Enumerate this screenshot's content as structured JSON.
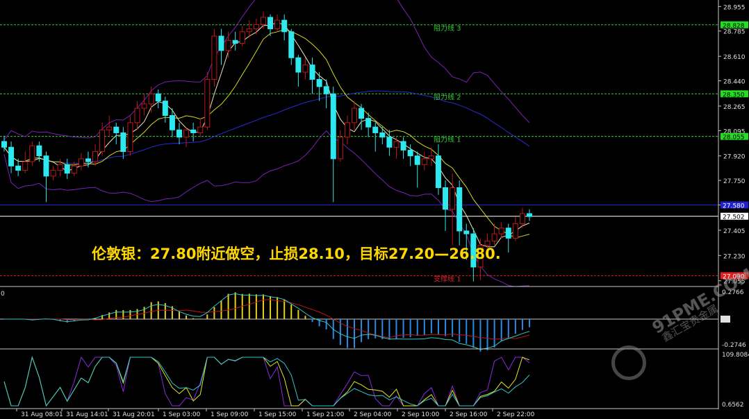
{
  "annotation": "伦敦银：27.80附近做空，止损28.10，目标27.20—26.80.",
  "watermark": {
    "site": "91PME.COM",
    "sub": "鑫汇宝贵金属"
  },
  "chart_data": {
    "type": "candlestick",
    "price_axis": {
      "ticks": [
        "28.955",
        "28.785",
        "28.610",
        "28.440",
        "28.265",
        "28.095",
        "27.920",
        "27.750",
        "27.580",
        "27.405",
        "27.230",
        "27.055"
      ],
      "ylim": [
        27.02,
        29.0
      ]
    },
    "time_axis": {
      "labels": [
        "31 Aug 08:01",
        "31 Aug 14:01",
        "31 Aug 20:01",
        "1 Sep 03:00",
        "1 Sep 09:00",
        "1 Sep 15:00",
        "1 Sep 21:00",
        "2 Sep 04:00",
        "2 Sep 10:00",
        "2 Sep 16:00",
        "2 Sep 22:00"
      ]
    },
    "levels": [
      {
        "label": "阻力线 3",
        "value": 28.828,
        "tag": "28.828",
        "color": "#2fcf2f"
      },
      {
        "label": "阻力线 2",
        "value": 28.35,
        "tag": "28.350",
        "color": "#2fcf2f"
      },
      {
        "label": "阻力线 1",
        "value": 28.055,
        "tag": "28.055",
        "color": "#2fcf2f"
      },
      {
        "label": "",
        "value": 27.58,
        "tag": "27.580",
        "color": "#2020d0"
      },
      {
        "label": "",
        "value": 27.502,
        "tag": "27.502",
        "color": "#ffffff"
      },
      {
        "label": "支撑线 1",
        "value": 27.09,
        "tag": "27.090",
        "color": "#e02020"
      }
    ],
    "candles": [
      [
        28.02,
        27.98,
        28.06,
        27.95
      ],
      [
        27.98,
        27.85,
        28.02,
        27.8
      ],
      [
        27.85,
        27.82,
        27.9,
        27.78
      ],
      [
        27.82,
        27.88,
        27.95,
        27.8
      ],
      [
        27.88,
        27.99,
        28.02,
        27.85
      ],
      [
        27.99,
        27.92,
        28.02,
        27.88
      ],
      [
        27.92,
        27.78,
        27.95,
        27.6
      ],
      [
        27.78,
        27.82,
        27.85,
        27.75
      ],
      [
        27.82,
        27.86,
        27.9,
        27.78
      ],
      [
        27.86,
        27.8,
        27.9,
        27.76
      ],
      [
        27.8,
        27.85,
        27.88,
        27.78
      ],
      [
        27.85,
        27.9,
        27.94,
        27.82
      ],
      [
        27.9,
        27.88,
        27.95,
        27.84
      ],
      [
        27.88,
        27.95,
        28.0,
        27.85
      ],
      [
        27.95,
        28.1,
        28.15,
        27.92
      ],
      [
        28.1,
        28.12,
        28.2,
        28.05
      ],
      [
        28.12,
        28.08,
        28.15,
        28.0
      ],
      [
        28.08,
        27.95,
        28.12,
        27.9
      ],
      [
        27.95,
        28.15,
        28.2,
        27.92
      ],
      [
        28.15,
        28.25,
        28.3,
        28.1
      ],
      [
        28.25,
        28.28,
        28.35,
        28.2
      ],
      [
        28.28,
        28.35,
        28.4,
        28.22
      ],
      [
        28.35,
        28.3,
        28.38,
        28.25
      ],
      [
        28.3,
        28.2,
        28.33,
        28.15
      ],
      [
        28.2,
        28.1,
        28.25,
        28.05
      ],
      [
        28.1,
        28.05,
        28.15,
        28.0
      ],
      [
        28.05,
        28.1,
        28.12,
        27.98
      ],
      [
        28.1,
        28.08,
        28.15,
        28.02
      ],
      [
        28.08,
        28.12,
        28.18,
        28.05
      ],
      [
        28.12,
        28.45,
        28.5,
        28.1
      ],
      [
        28.45,
        28.75,
        28.8,
        28.4
      ],
      [
        28.75,
        28.65,
        28.8,
        28.55
      ],
      [
        28.65,
        28.72,
        28.78,
        28.6
      ],
      [
        28.72,
        28.7,
        28.78,
        28.65
      ],
      [
        28.7,
        28.78,
        28.82,
        28.68
      ],
      [
        28.78,
        28.8,
        28.86,
        28.74
      ],
      [
        28.8,
        28.83,
        28.87,
        28.76
      ],
      [
        28.83,
        28.88,
        28.92,
        28.8
      ],
      [
        28.88,
        28.8,
        28.9,
        28.75
      ],
      [
        28.8,
        28.86,
        28.9,
        28.78
      ],
      [
        28.86,
        28.78,
        28.9,
        28.72
      ],
      [
        28.78,
        28.6,
        28.8,
        28.55
      ],
      [
        28.6,
        28.5,
        28.62,
        28.4
      ],
      [
        28.5,
        28.55,
        28.6,
        28.45
      ],
      [
        28.55,
        28.45,
        28.6,
        28.35
      ],
      [
        28.45,
        28.4,
        28.5,
        28.3
      ],
      [
        28.4,
        28.35,
        28.45,
        28.25
      ],
      [
        28.35,
        27.9,
        28.4,
        27.6
      ],
      [
        27.9,
        28.05,
        28.1,
        27.88
      ],
      [
        28.05,
        28.15,
        28.2,
        28.0
      ],
      [
        28.15,
        28.25,
        28.3,
        28.1
      ],
      [
        28.25,
        28.18,
        28.28,
        28.1
      ],
      [
        28.18,
        28.12,
        28.22,
        28.05
      ],
      [
        28.12,
        28.08,
        28.15,
        27.95
      ],
      [
        28.08,
        28.05,
        28.12,
        28.0
      ],
      [
        28.05,
        27.98,
        28.1,
        27.92
      ],
      [
        27.98,
        28.02,
        28.05,
        27.9
      ],
      [
        28.02,
        27.96,
        28.05,
        27.9
      ],
      [
        27.96,
        27.92,
        28.0,
        27.85
      ],
      [
        27.92,
        27.86,
        27.95,
        27.7
      ],
      [
        27.86,
        27.9,
        27.95,
        27.82
      ],
      [
        27.9,
        27.92,
        27.98,
        27.85
      ],
      [
        27.92,
        27.7,
        28.0,
        27.65
      ],
      [
        27.7,
        27.55,
        27.75,
        27.4
      ],
      [
        27.55,
        27.7,
        27.8,
        27.3
      ],
      [
        27.7,
        27.4,
        27.75,
        27.3
      ],
      [
        27.4,
        27.38,
        27.45,
        27.2
      ],
      [
        27.38,
        27.15,
        27.42,
        27.05
      ],
      [
        27.15,
        27.3,
        27.35,
        27.06
      ],
      [
        27.3,
        27.33,
        27.38,
        27.28
      ],
      [
        27.33,
        27.38,
        27.45,
        27.3
      ],
      [
        27.38,
        27.42,
        27.46,
        27.35
      ],
      [
        27.42,
        27.35,
        27.45,
        27.25
      ],
      [
        27.35,
        27.45,
        27.5,
        27.33
      ],
      [
        27.45,
        27.52,
        27.56,
        27.42
      ],
      [
        27.52,
        27.5,
        27.55,
        27.47
      ]
    ],
    "macd": {
      "scale_top": "0.2766",
      "scale_bottom": "-0.2746",
      "left_label": "0"
    },
    "oscillator": {
      "scale_top": "109.8084",
      "scale_bottom": "0.6562"
    }
  }
}
